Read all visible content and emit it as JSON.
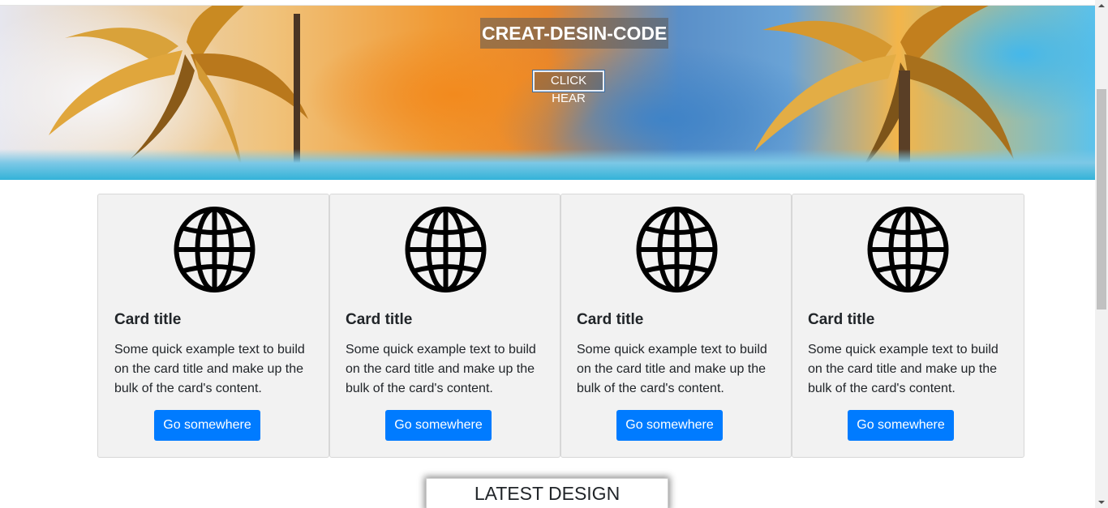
{
  "hero": {
    "title": "CREAT-DESIN-CODE",
    "button_label": "CLICK HEAR"
  },
  "cards": [
    {
      "icon": "globe-icon",
      "title": "Card title",
      "text": "Some quick example text to build on the card title and make up the bulk of the card's content.",
      "button_label": "Go somewhere"
    },
    {
      "icon": "globe-icon",
      "title": "Card title",
      "text": "Some quick example text to build on the card title and make up the bulk of the card's content.",
      "button_label": "Go somewhere"
    },
    {
      "icon": "globe-icon",
      "title": "Card title",
      "text": "Some quick example text to build on the card title and make up the bulk of the card's content.",
      "button_label": "Go somewhere"
    },
    {
      "icon": "globe-icon",
      "title": "Card title",
      "text": "Some quick example text to build on the card title and make up the bulk of the card's content.",
      "button_label": "Go somewhere"
    }
  ],
  "section_heading": "LATEST DESIGN PROJECTS",
  "colors": {
    "primary_button": "#007bff",
    "card_background": "#f2f2f2"
  }
}
